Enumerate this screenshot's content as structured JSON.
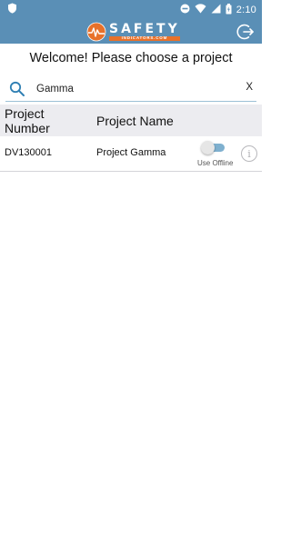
{
  "status_bar": {
    "time": "2:10",
    "icons": [
      "shield-icon",
      "do-not-disturb-icon",
      "wifi-icon",
      "cell-signal-icon",
      "battery-icon"
    ]
  },
  "header": {
    "brand_name": "SAFETY",
    "brand_sub": "INDICATORS.COM",
    "logout_icon": "logout-icon"
  },
  "welcome_text": "Welcome! Please choose a project",
  "search": {
    "value": "Gamma",
    "clear_label": "X"
  },
  "table": {
    "headers": {
      "number": "Project Number",
      "name": "Project Name"
    },
    "rows": [
      {
        "number": "DV130001",
        "name": "Project Gamma",
        "offline_label": "Use Offline",
        "info_label": "i"
      }
    ]
  },
  "colors": {
    "header_bg": "#5a8fb6",
    "accent_orange": "#e8712a",
    "table_header_bg": "#ececf0",
    "search_underline": "#9cc0d6"
  }
}
